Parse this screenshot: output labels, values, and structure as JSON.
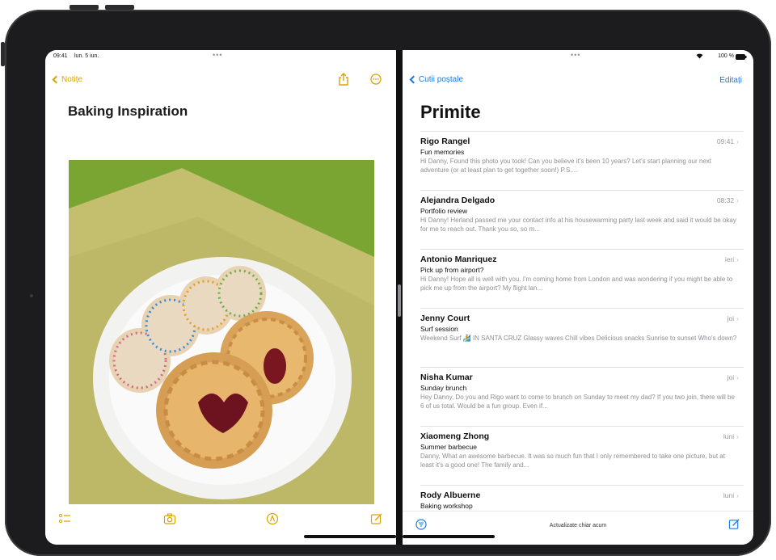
{
  "status": {
    "time": "09:41",
    "date": "lun. 5 iun.",
    "battery": "100 %"
  },
  "notes": {
    "back_label": "Notițe",
    "title": "Baking Inspiration",
    "photo": "plate-of-cookies-image",
    "toolbar": [
      "checklist-icon",
      "camera-icon",
      "markup-icon",
      "compose-icon"
    ]
  },
  "mail": {
    "back_label": "Cutii poștale",
    "edit_label": "Editați",
    "title": "Primite",
    "messages": [
      {
        "sender": "Rigo Rangel",
        "time": "09:41",
        "subject": "Fun memories",
        "preview": "Hi Danny, Found this photo you took! Can you believe it's been 10 years? Let's start planning our next adventure (or at least plan to get together soon!) P.S...."
      },
      {
        "sender": "Alejandra Delgado",
        "time": "08:32",
        "subject": "Portfolio review",
        "preview": "Hi Danny! Herland passed me your contact info at his housewarming party last week and said it would be okay for me to reach out. Thank you so, so m..."
      },
      {
        "sender": "Antonio Manriquez",
        "time": "ieri",
        "subject": "Pick up from airport?",
        "preview": "Hi Danny! Hope all is well with you. I'm coming home from London and was wondering if you might be able to pick me up from the airport? My flight lan..."
      },
      {
        "sender": "Jenny Court",
        "time": "joi",
        "subject": "Surf session",
        "preview": "Weekend Surf 🏄 IN SANTA CRUZ Glassy waves Chill vibes Delicious snacks Sunrise to sunset Who's down?"
      },
      {
        "sender": "Nisha Kumar",
        "time": "joi",
        "subject": "Sunday brunch",
        "preview": "Hey Danny, Do you and Rigo want to come to brunch on Sunday to meet my dad? If you two join, there will be 6 of us total. Would be a fun group. Even if..."
      },
      {
        "sender": "Xiaomeng Zhong",
        "time": "luni",
        "subject": "Summer barbecue",
        "preview": "Danny, What an awesome barbecue. It was so much fun that I only remembered to take one picture, but at least it's a good one! The family and..."
      },
      {
        "sender": "Rody Albuerne",
        "time": "luni",
        "subject": "Baking workshop",
        "preview": ""
      }
    ],
    "footer_status": "Actualizate chiar acum",
    "footer_icons": [
      "filter-icon",
      "compose-icon"
    ]
  },
  "colors": {
    "notes_accent": "#d9a400",
    "mail_accent": "#1a7ae0"
  }
}
